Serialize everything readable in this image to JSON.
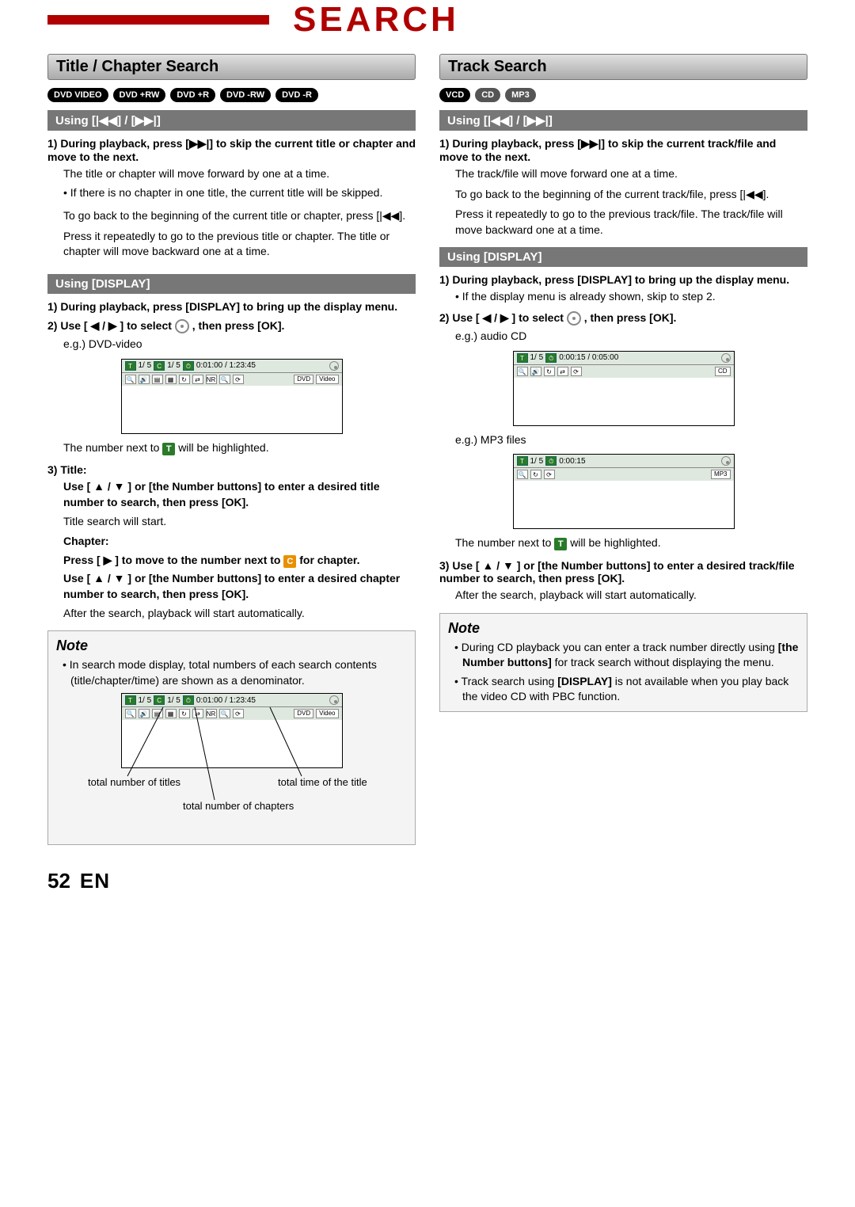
{
  "header": {
    "title": "SEARCH"
  },
  "left": {
    "section_title": "Title / Chapter Search",
    "discs": [
      "DVD VIDEO",
      "DVD +RW",
      "DVD +R",
      "DVD -RW",
      "DVD -R"
    ],
    "sub1": "Using [|◀◀] / [▶▶|]",
    "s1a": "1)",
    "s1a_text": "During playback, press [▶▶|] to skip the current title or chapter and move to the next.",
    "s1a_sub": "The title or chapter will move forward by one at a time.",
    "s1a_bullet": "If there is no chapter in one title, the current title will be skipped.",
    "s1a_p2": "To go back to the beginning of the current title or chapter, press [|◀◀].",
    "s1a_p3": "Press it repeatedly to go to the previous title or chapter. The title or chapter will move backward one at a time.",
    "sub2": "Using [DISPLAY]",
    "s2a": "1)",
    "s2a_text": "During playback, press [DISPLAY] to bring up the display menu.",
    "s2b": "2)",
    "s2b_text_a": "Use [ ◀ / ▶ ] to select ",
    "s2b_text_b": " , then press [OK].",
    "s2b_eg": "e.g.) DVD-video",
    "osd1": {
      "t": "T",
      "tv": "1/ 5",
      "c": "C",
      "cv": "1/ 5",
      "time": "0:01:00 / 1:23:45",
      "tags": [
        "DVD",
        "Video"
      ]
    },
    "s2b_after_a": "The number next to ",
    "s2b_after_b": " will be highlighted.",
    "s3": "3)",
    "s3_title": "Title:",
    "s3_title_text": "Use [ ▲ / ▼ ] or [the Number buttons] to enter a desired title number to search, then press [OK].",
    "s3_title_sub": "Title search will start.",
    "s3_chapter": "Chapter:",
    "s3_chapter_text_a": "Press [ ▶ ] to move to the number next to ",
    "s3_chapter_text_b": " for chapter.",
    "s3_chapter_text2": "Use [ ▲ / ▼ ] or [the Number buttons] to enter a desired chapter number to search, then press [OK].",
    "s3_chapter_sub": "After the search, playback will start automatically.",
    "note_title": "Note",
    "note_bullet": "In search mode display, total numbers of each search contents (title/chapter/time) are shown as a denominator.",
    "osd2": {
      "t": "T",
      "tv": "1/ 5",
      "c": "C",
      "cv": "1/ 5",
      "time": "0:01:00 / 1:23:45",
      "tags": [
        "DVD",
        "Video"
      ]
    },
    "call1": "total number of titles",
    "call2": "total number of chapters",
    "call3": "total time of the title"
  },
  "right": {
    "section_title": "Track Search",
    "discs": [
      "VCD",
      "CD",
      "MP3"
    ],
    "sub1": "Using [|◀◀] / [▶▶|]",
    "r1a": "1)",
    "r1a_text": "During playback, press [▶▶|] to skip the current track/file and move to the next.",
    "r1a_sub": "The track/file will move forward one at a time.",
    "r1a_p2": "To go back to the beginning of the current track/file, press [|◀◀].",
    "r1a_p3": "Press it repeatedly to go to the previous track/file. The track/file will move backward one at a time.",
    "sub2": "Using [DISPLAY]",
    "r2a": "1)",
    "r2a_text": "During playback, press [DISPLAY] to bring up the display menu.",
    "r2a_bullet": "If the display menu is already shown, skip to step 2.",
    "r2b": "2)",
    "r2b_text_a": "Use [ ◀ / ▶ ] to select ",
    "r2b_text_b": " , then press [OK].",
    "r2b_eg1": "e.g.) audio CD",
    "osd1": {
      "t": "T",
      "tv": "1/ 5",
      "time": "0:00:15 / 0:05:00",
      "tag": "CD"
    },
    "r2b_eg2": "e.g.) MP3 files",
    "osd2": {
      "t": "T",
      "tv": "1/ 5",
      "time": "0:00:15",
      "tag": "MP3"
    },
    "r2b_after_a": "The number next to ",
    "r2b_after_b": " will be highlighted.",
    "r3": "3)",
    "r3_text": "Use [ ▲ / ▼ ] or [the Number buttons] to enter a desired track/file number to search, then press [OK].",
    "r3_sub": "After the search, playback will start automatically.",
    "note_title": "Note",
    "note_b1a": "During CD playback you can enter a track number directly using ",
    "note_b1b": "[the Number buttons]",
    "note_b1c": " for track search without displaying the menu.",
    "note_b2a": "Track search using ",
    "note_b2b": "[DISPLAY]",
    "note_b2c": " is not available when you play back the video CD with PBC function."
  },
  "footer": {
    "page": "52",
    "lang": "EN"
  }
}
